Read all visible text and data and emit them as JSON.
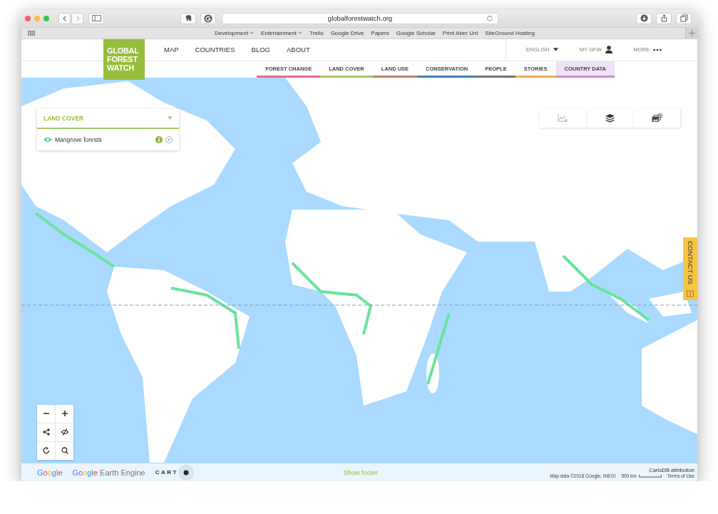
{
  "browser": {
    "url": "globalforestwatch.org"
  },
  "bookmarks": [
    {
      "label": "Development",
      "kind": "folder"
    },
    {
      "label": "Entertainment",
      "kind": "folder"
    },
    {
      "label": "Trello",
      "kind": "link"
    },
    {
      "label": "Google Drive",
      "kind": "link"
    },
    {
      "label": "Papers",
      "kind": "link"
    },
    {
      "label": "Google Scholar",
      "kind": "link"
    },
    {
      "label": "Print Aber Uni",
      "kind": "link"
    },
    {
      "label": "SiteGround Hosting",
      "kind": "link"
    }
  ],
  "site": {
    "logo": [
      "GLOBAL",
      "FOREST",
      "WATCH"
    ],
    "nav": [
      "MAP",
      "COUNTRIES",
      "BLOG",
      "ABOUT"
    ],
    "language": "ENGLISH",
    "account": "MY GFW",
    "more": "MORE"
  },
  "categories": [
    {
      "label": "FOREST CHANGE",
      "color": "#e8688f",
      "selected": false
    },
    {
      "label": "LAND COVER",
      "color": "#a7c96b",
      "selected": false
    },
    {
      "label": "LAND USE",
      "color": "#b9866a",
      "selected": false
    },
    {
      "label": "CONSERVATION",
      "color": "#3f7fbf",
      "selected": false
    },
    {
      "label": "PEOPLE",
      "color": "#6c7480",
      "selected": false
    },
    {
      "label": "STORIES",
      "color": "#f0ac52",
      "selected": false
    },
    {
      "label": "COUNTRY DATA",
      "color": "#c48fd8",
      "selected": true
    }
  ],
  "layer_panel": {
    "title": "LAND COVER",
    "layers": [
      {
        "name": "Mangrove forests",
        "visible": true
      }
    ]
  },
  "contact_tab": "CONTACT US",
  "footer": {
    "logos": [
      {
        "kind": "google",
        "text": "Google"
      },
      {
        "kind": "earth-engine",
        "text": "Google",
        "suffix": "Earth Engine"
      },
      {
        "kind": "carto",
        "text": "CART"
      }
    ],
    "show_footer": "Show footer",
    "attribution": "CartoDB attribution",
    "map_data": "Map data ©2018 Google, INEGI",
    "scale": "500 km",
    "terms": "Terms of Use"
  }
}
